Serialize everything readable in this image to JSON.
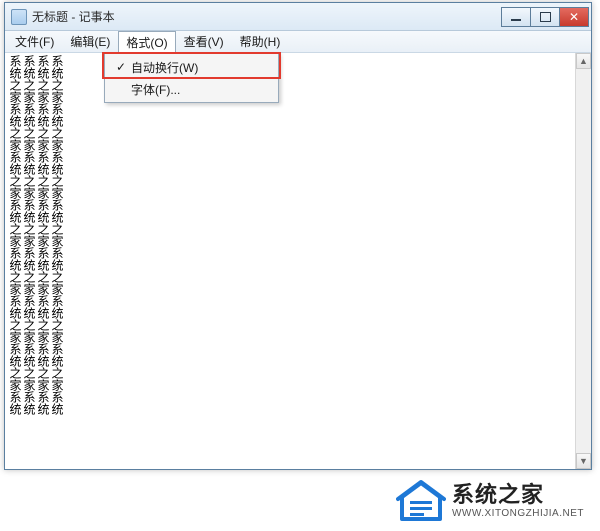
{
  "title": "无标题 - 记事本",
  "menus": {
    "file": "文件(F)",
    "edit": "编辑(E)",
    "format": "格式(O)",
    "view": "查看(V)",
    "help": "帮助(H)"
  },
  "dropdown": {
    "wordwrap": "自动换行(W)",
    "font": "字体(F)..."
  },
  "editor": {
    "columns": [
      "系统之家系统之家系统之家系统之家系统之家系统之家系统之家系统",
      "系统之家系统之家系统之家系统之家系统之家系统之家系统之家系统",
      "系统之家系统之家系统之家系统之家系统之家系统之家系统之家系统",
      "系统之家系统之家系统之家系统之家系统之家系统之家系统之家系统"
    ]
  },
  "watermark": {
    "cn": "系统之家",
    "en": "WWW.XITONGZHIJIA.NET"
  }
}
